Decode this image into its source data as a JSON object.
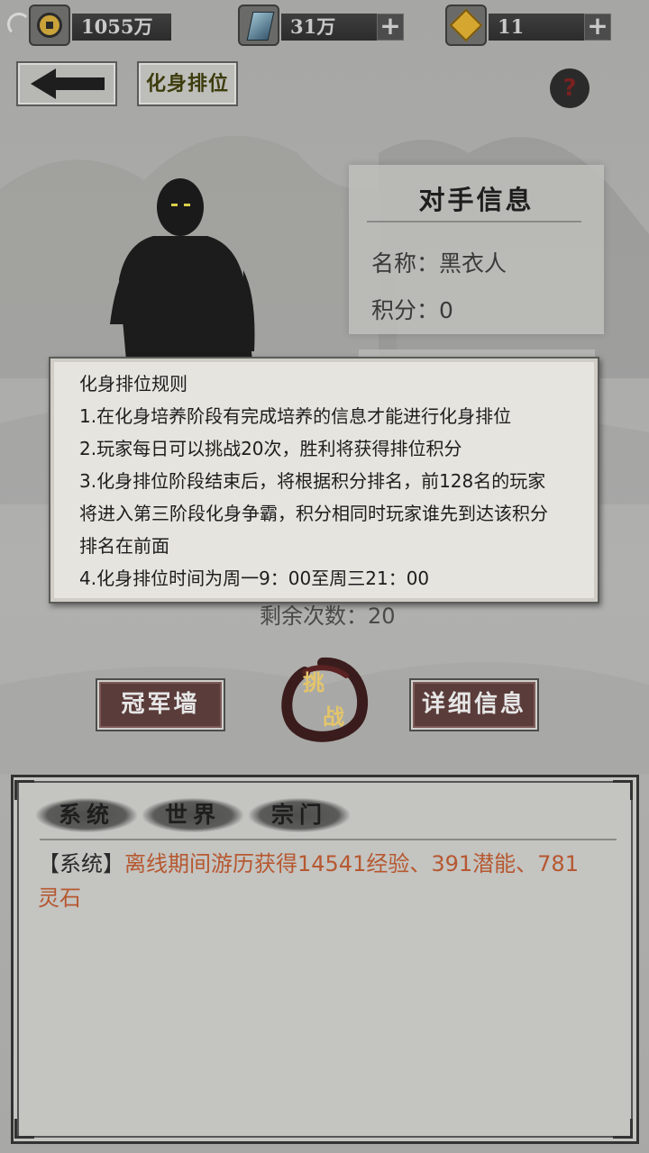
{
  "resources": [
    {
      "icon": "coin-icon",
      "value": "1055万"
    },
    {
      "icon": "crystal-icon",
      "value": "31万",
      "plus": "+"
    },
    {
      "icon": "gold-ingot-icon",
      "value": "11",
      "plus": "+"
    }
  ],
  "header": {
    "back_icon": "arrow-left-icon",
    "title": "化身排位",
    "help": "?"
  },
  "opponent": {
    "title": "对手信息",
    "name_label": "名称：",
    "name": "黑衣人",
    "score_label": "积分：",
    "score": "0"
  },
  "rules": {
    "title": "化身排位规则",
    "lines": [
      "1.在化身培养阶段有完成培养的信息才能进行化身排位",
      "2.玩家每日可以挑战20次，胜利将获得排位积分",
      "3.化身排位阶段结束后，将根据积分排名，前128名的玩家",
      "将进入第三阶段化身争霸，积分相同时玩家谁先到达该积分",
      "排名在前面",
      "4.化身排位时间为周一9：00至周三21：00"
    ]
  },
  "remaining": "剩余次数：20",
  "buttons": {
    "champion_wall": "冠军墙",
    "challenge_1": "挑",
    "challenge_2": "战",
    "details": "详细信息"
  },
  "chat": {
    "tabs": [
      "系统",
      "世界",
      "宗门"
    ],
    "message_tag": "【系统】",
    "message": "离线期间游历获得14541经验、391潜能、781灵石"
  },
  "colors": {
    "message": "#b65830",
    "accent": "#e4c56a",
    "button": "#5a3c3a"
  }
}
